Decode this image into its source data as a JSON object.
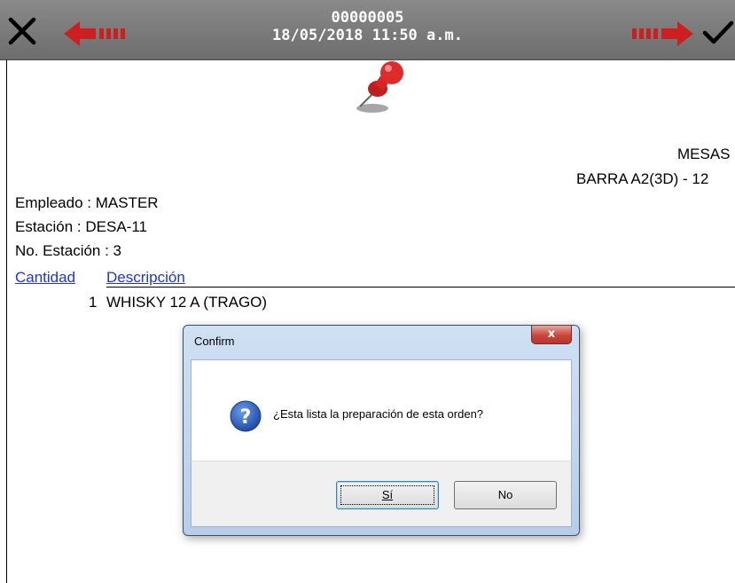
{
  "header": {
    "order_number": "00000005",
    "datetime": "18/05/2018 11:50 a.m."
  },
  "ticket": {
    "area": "MESAS",
    "table": "BARRA A2(3D) - 12",
    "employee": "Empleado : MASTER",
    "station": "Estación : DESA-11",
    "station_no": "No. Estación : 3",
    "columns": {
      "qty": "Cantidad",
      "desc": "Descripción"
    },
    "items": [
      {
        "qty": "1",
        "desc": "WHISKY 12 A (TRAGO)"
      }
    ]
  },
  "dialog": {
    "title": "Confirm",
    "close": "x",
    "message": "¿Esta lista la preparación de esta orden?",
    "yes_label": "Sí",
    "no_label": "No"
  },
  "colors": {
    "arrow": "#cc1f1f",
    "topbar": "#7b7b7b",
    "link": "#1f35d6"
  }
}
